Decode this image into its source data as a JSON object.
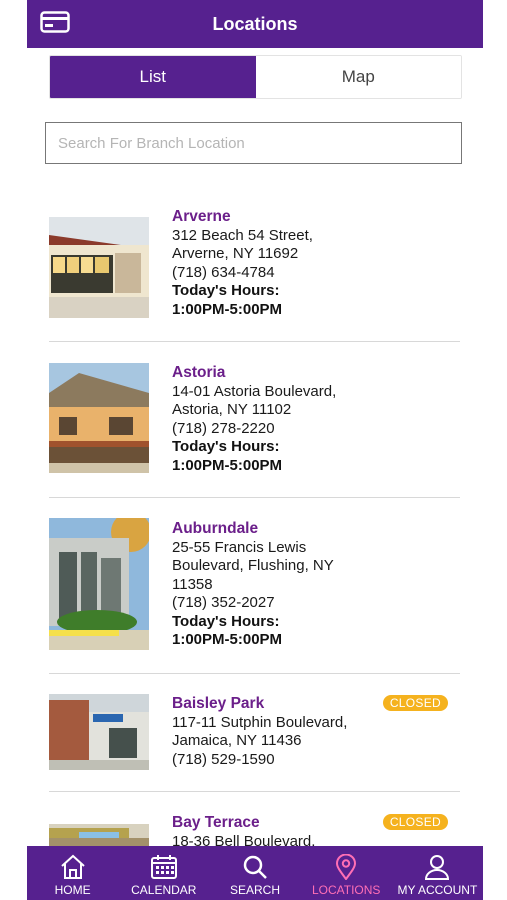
{
  "header": {
    "title": "Locations",
    "menu_icon": "card-icon"
  },
  "segment": {
    "list_label": "List",
    "map_label": "Map",
    "selected": "List"
  },
  "search": {
    "placeholder": "Search For Branch Location",
    "value": ""
  },
  "locations": [
    {
      "name": "Arverne",
      "address1": "312 Beach 54 Street,",
      "address2": "Arverne, NY 11692",
      "address3": "",
      "phone": "(718) 634-4784",
      "hours_label": "Today's Hours:",
      "hours": "1:00PM-5:00PM",
      "badge": ""
    },
    {
      "name": "Astoria",
      "address1": "14-01 Astoria Boulevard,",
      "address2": "Astoria, NY 11102",
      "address3": "",
      "phone": "(718) 278-2220",
      "hours_label": "Today's Hours:",
      "hours": "1:00PM-5:00PM",
      "badge": ""
    },
    {
      "name": "Auburndale",
      "address1": "25-55 Francis Lewis",
      "address2": "Boulevard, Flushing, NY",
      "address3": "11358",
      "phone": "(718) 352-2027",
      "hours_label": "Today's Hours:",
      "hours": "1:00PM-5:00PM",
      "badge": ""
    },
    {
      "name": "Baisley Park",
      "address1": "117-11 Sutphin Boulevard,",
      "address2": "Jamaica, NY 11436",
      "address3": "",
      "phone": "(718) 529-1590",
      "hours_label": "",
      "hours": "",
      "badge": "CLOSED"
    },
    {
      "name": "Bay Terrace",
      "address1": "18-36 Bell Boulevard,",
      "address2": "",
      "address3": "",
      "phone": "",
      "hours_label": "",
      "hours": "",
      "badge": "CLOSED"
    }
  ],
  "tabbar": {
    "items": [
      {
        "label": "HOME",
        "icon": "home-icon"
      },
      {
        "label": "CALENDAR",
        "icon": "calendar-icon"
      },
      {
        "label": "SEARCH",
        "icon": "search-icon"
      },
      {
        "label": "LOCATIONS",
        "icon": "location-pin-icon"
      },
      {
        "label": "MY ACCOUNT",
        "icon": "account-icon"
      }
    ],
    "active": "LOCATIONS"
  },
  "colors": {
    "brand": "#56218f",
    "name": "#6b1f8a",
    "badge": "#f5b21e",
    "active_tab": "#ff6fb5"
  }
}
